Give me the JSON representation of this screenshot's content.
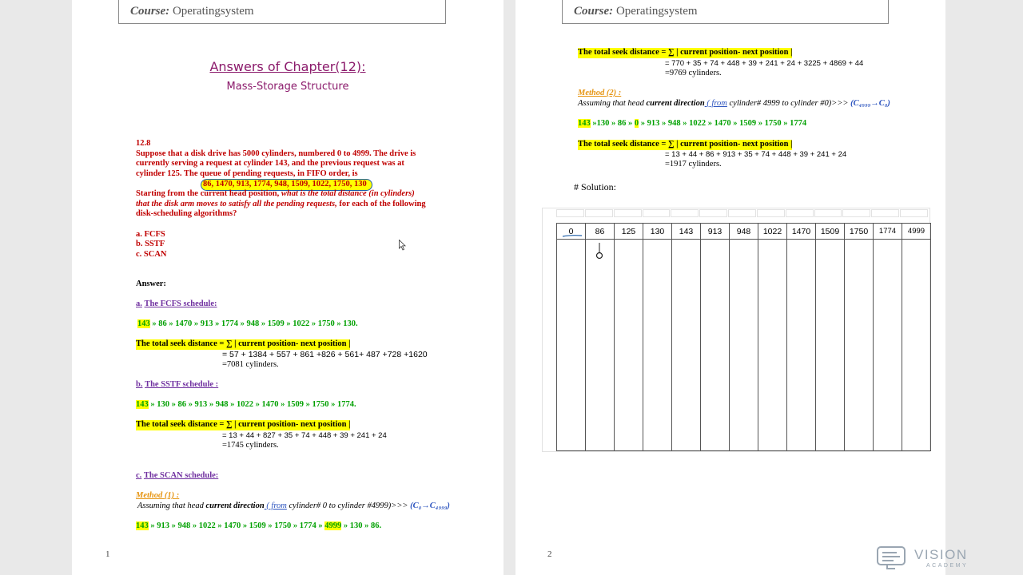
{
  "header": {
    "course_label": "Course:",
    "course_name": " Operatingsystem"
  },
  "page1": {
    "title": "Answers of Chapter(12):",
    "subtitle": "Mass-Storage Structure",
    "q_number": "12.8",
    "q_line1": "Suppose that a disk drive has 5000 cylinders, numbered 0 to 4999. The drive is",
    "q_line2": "currently serving a request at cylinder 143, and the previous request was at",
    "q_line3": "cylinder 125. The queue of pending requests, in FIFO order, is",
    "queue": "86, 1470, 913, 1774, 948, 1509, 1022, 1750, 130",
    "q_line5a": "Starting from the current head position,",
    "q_line5b": " what is the total distance (in cylinders)",
    "q_line6a": "that the disk arm moves to satisfy all the pending requests,",
    "q_line6b": " for each of the following",
    "q_line7": "disk-scheduling algorithms?",
    "opt_a": "a. FCFS",
    "opt_b": "b. SSTF",
    "opt_c": "c. SCAN",
    "answer": "Answer:",
    "fcfs_prefix": "a.",
    "fcfs_title": "The FCFS schedule:",
    "fcfs_start": "143",
    "fcfs_seq": " » 86 » 1470 » 913 » 1774 » 948 » 1509 » 1022 » 1750 »  130.",
    "total_label": "The total seek distance = ∑  |  current position- next position |",
    "fcfs_calc": "= 57 + 1384 + 557 + 861 +826 + 561+ 487 +728 +1620",
    "fcfs_result": "=7081 cylinders.",
    "sstf_prefix": "b.",
    "sstf_title": "The SSTF schedule :",
    "sstf_start": "143",
    "sstf_seq": " » 130 » 86 » 913 » 948 » 1022 » 1470 » 1509 » 1750 » 1774.",
    "sstf_calc": "= 13 + 44 + 827 + 35 + 74 + 448 + 39 + 241 + 24",
    "sstf_result": "=1745 cylinders.",
    "scan_prefix": "c.",
    "scan_title": "The SCAN schedule:",
    "method1": "Method (1) :",
    "method1_text_a": "Assuming that head ",
    "method1_text_b": "current direction",
    "method1_text_c": " ( from",
    "method1_text_d": " cylinder# 0 to cylinder #4999)>>> ",
    "method1_dir": "(C₀→C₄₉₉₉)",
    "scan1_start": "143",
    "scan1_seq": " » 913 » 948 » 1022 » 1470 » 1509 » 1750 » 1774 » ",
    "scan1_end": "4999",
    "scan1_tail": " » 130 »  86.",
    "page_number": "1"
  },
  "page2": {
    "total_label": "The total seek distance = ∑  |  current position- next position |",
    "scan1_calc": "= 770 + 35 + 74 + 448 + 39 + 241 + 24 + 3225 + 4869 + 44",
    "scan1_result": "=9769 cylinders.",
    "method2": "Method (2) :",
    "method2_text_a": "Assuming that head ",
    "method2_text_b": "current direction",
    "method2_text_c": " ( from",
    "method2_text_d": " cylinder# 4999 to cylinder #0)>>> ",
    "method2_dir": "(C₄₉₉₉→C₀)",
    "scan2_start": "143",
    "scan2_mid1": " »130 » 86 » ",
    "scan2_zero": "0",
    "scan2_seq": " » 913 » 948 » 1022 » 1470 » 1509 » 1750 »  1774",
    "scan2_calc": "= 13 + 44 + 86 + 913 + 35 + 74 + 448 + 39 + 241 + 24",
    "scan2_result": "=1917 cylinders.",
    "solution": "# Solution:",
    "grid_headers": [
      "0",
      "86",
      "125",
      "130",
      "143",
      "913",
      "948",
      "1022",
      "1470",
      "1509",
      "1750",
      "1774",
      "4999"
    ],
    "page_number": "2"
  },
  "logo": {
    "name": "VISION",
    "sub": "ACADEMY",
    "color": "#9aa6b2"
  }
}
